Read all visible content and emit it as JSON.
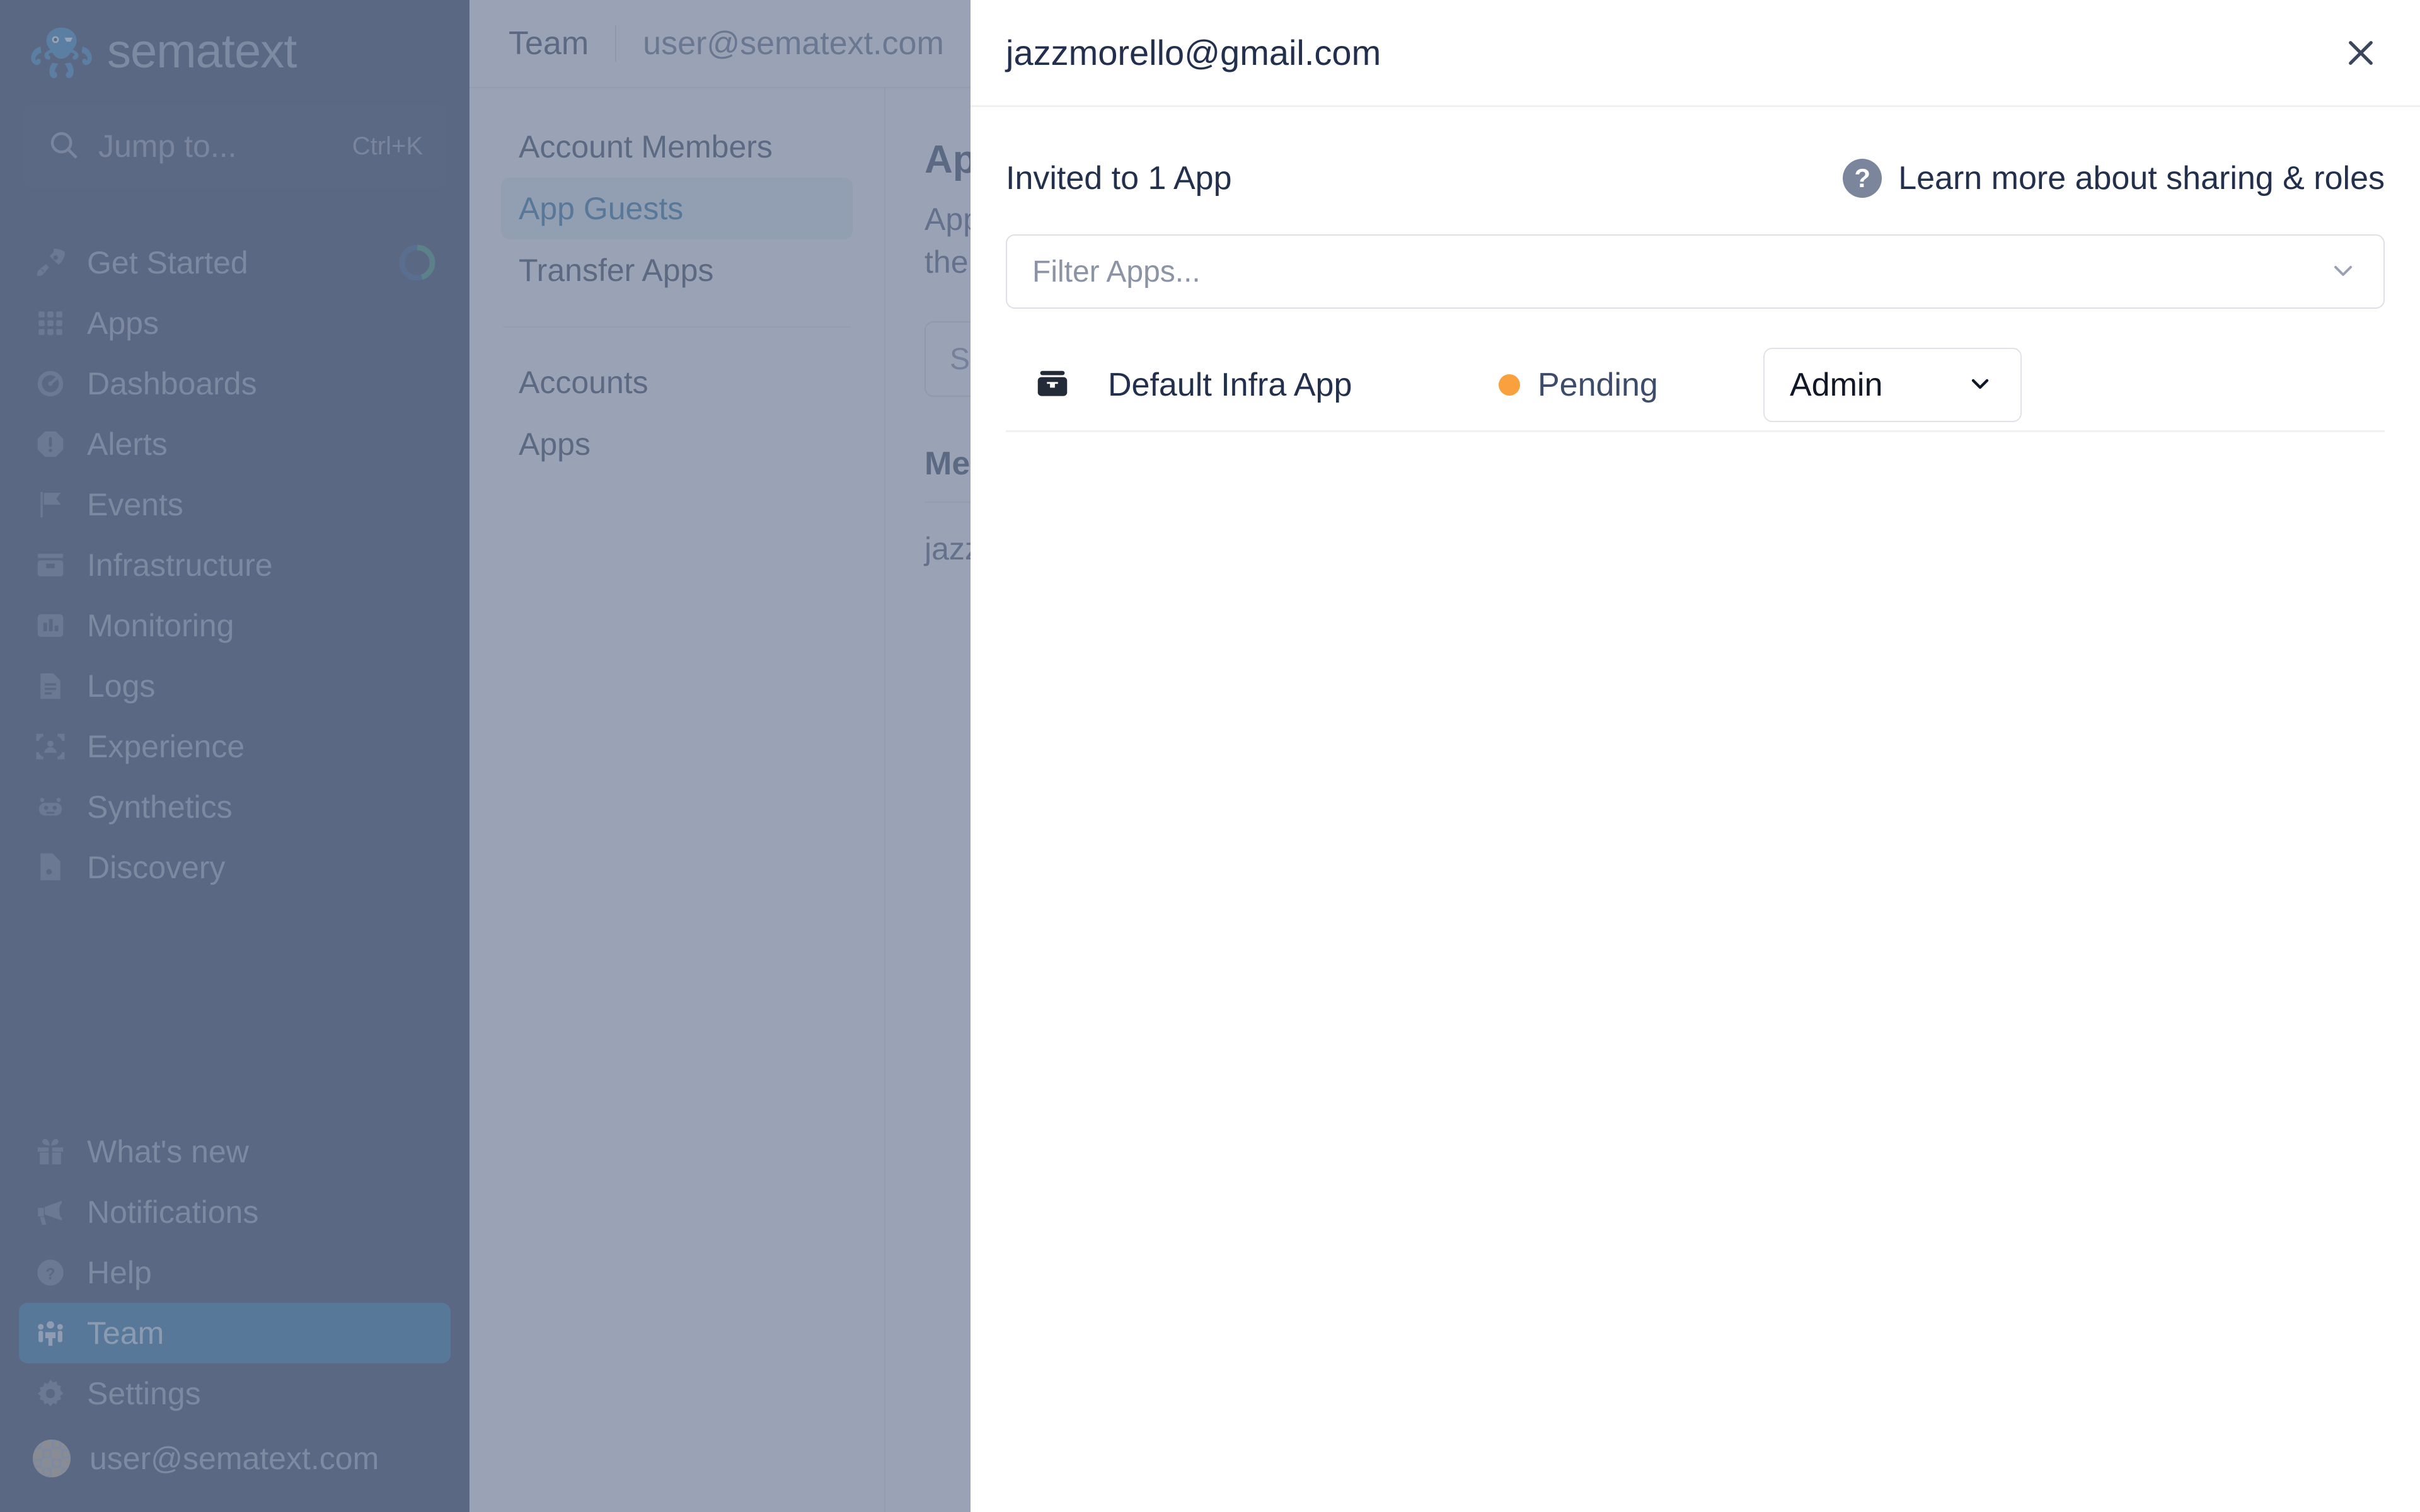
{
  "sidebar": {
    "brand": "sematext",
    "search": {
      "placeholder": "Jump to...",
      "shortcut": "Ctrl+K"
    },
    "get_started": {
      "label": "Get Started",
      "progress_percent": 45
    },
    "items": [
      {
        "label": "Apps",
        "icon": "grid-icon"
      },
      {
        "label": "Dashboards",
        "icon": "gauge-icon"
      },
      {
        "label": "Alerts",
        "icon": "alert-octagon-icon"
      },
      {
        "label": "Events",
        "icon": "flag-icon"
      },
      {
        "label": "Infrastructure",
        "icon": "server-icon"
      },
      {
        "label": "Monitoring",
        "icon": "bar-chart-icon"
      },
      {
        "label": "Logs",
        "icon": "document-lines-icon"
      },
      {
        "label": "Experience",
        "icon": "user-frame-icon"
      },
      {
        "label": "Synthetics",
        "icon": "robot-icon"
      },
      {
        "label": "Discovery",
        "icon": "file-search-icon"
      }
    ],
    "bottom_items": [
      {
        "label": "What's new",
        "icon": "gift-icon",
        "active": false
      },
      {
        "label": "Notifications",
        "icon": "megaphone-icon",
        "active": false
      },
      {
        "label": "Help",
        "icon": "question-circle-icon",
        "active": false
      },
      {
        "label": "Team",
        "icon": "team-icon",
        "active": true
      },
      {
        "label": "Settings",
        "icon": "gear-icon",
        "active": false
      }
    ],
    "account": {
      "email": "user@sematext.com",
      "icon": "avatar"
    },
    "accent_active": "#15679f",
    "background": "#1d2b4b"
  },
  "topbar": {
    "breadcrumb_section": "Team",
    "breadcrumb_account": "user@sematext.com"
  },
  "subnav": {
    "group_one": [
      {
        "label": "Account Members",
        "active": false
      },
      {
        "label": "App Guests",
        "active": true
      },
      {
        "label": "Transfer Apps",
        "active": false
      }
    ],
    "group_two": [
      {
        "label": "Accounts",
        "active": false
      },
      {
        "label": "Apps",
        "active": false
      }
    ]
  },
  "main": {
    "title": "App Guests",
    "description_line1": "App Guests are users who were invited to",
    "description_line2": "the individual apps",
    "search_placeholder": "Search",
    "table_header": "Member",
    "first_cell": "jazzmorello@gmail.com"
  },
  "modal": {
    "title": "jazzmorello@gmail.com",
    "close_label": "Close",
    "invited_label": "Invited to 1 App",
    "learn_more": "Learn more about sharing & roles",
    "help_glyph": "?",
    "filter": {
      "placeholder": "Filter Apps...",
      "value": ""
    },
    "apps": [
      {
        "icon": "infra-app-icon",
        "name": "Default Infra App",
        "status": "Pending",
        "status_color": "#faa03c",
        "role": "Admin"
      }
    ]
  },
  "overlay": {
    "color": "#737f99"
  }
}
